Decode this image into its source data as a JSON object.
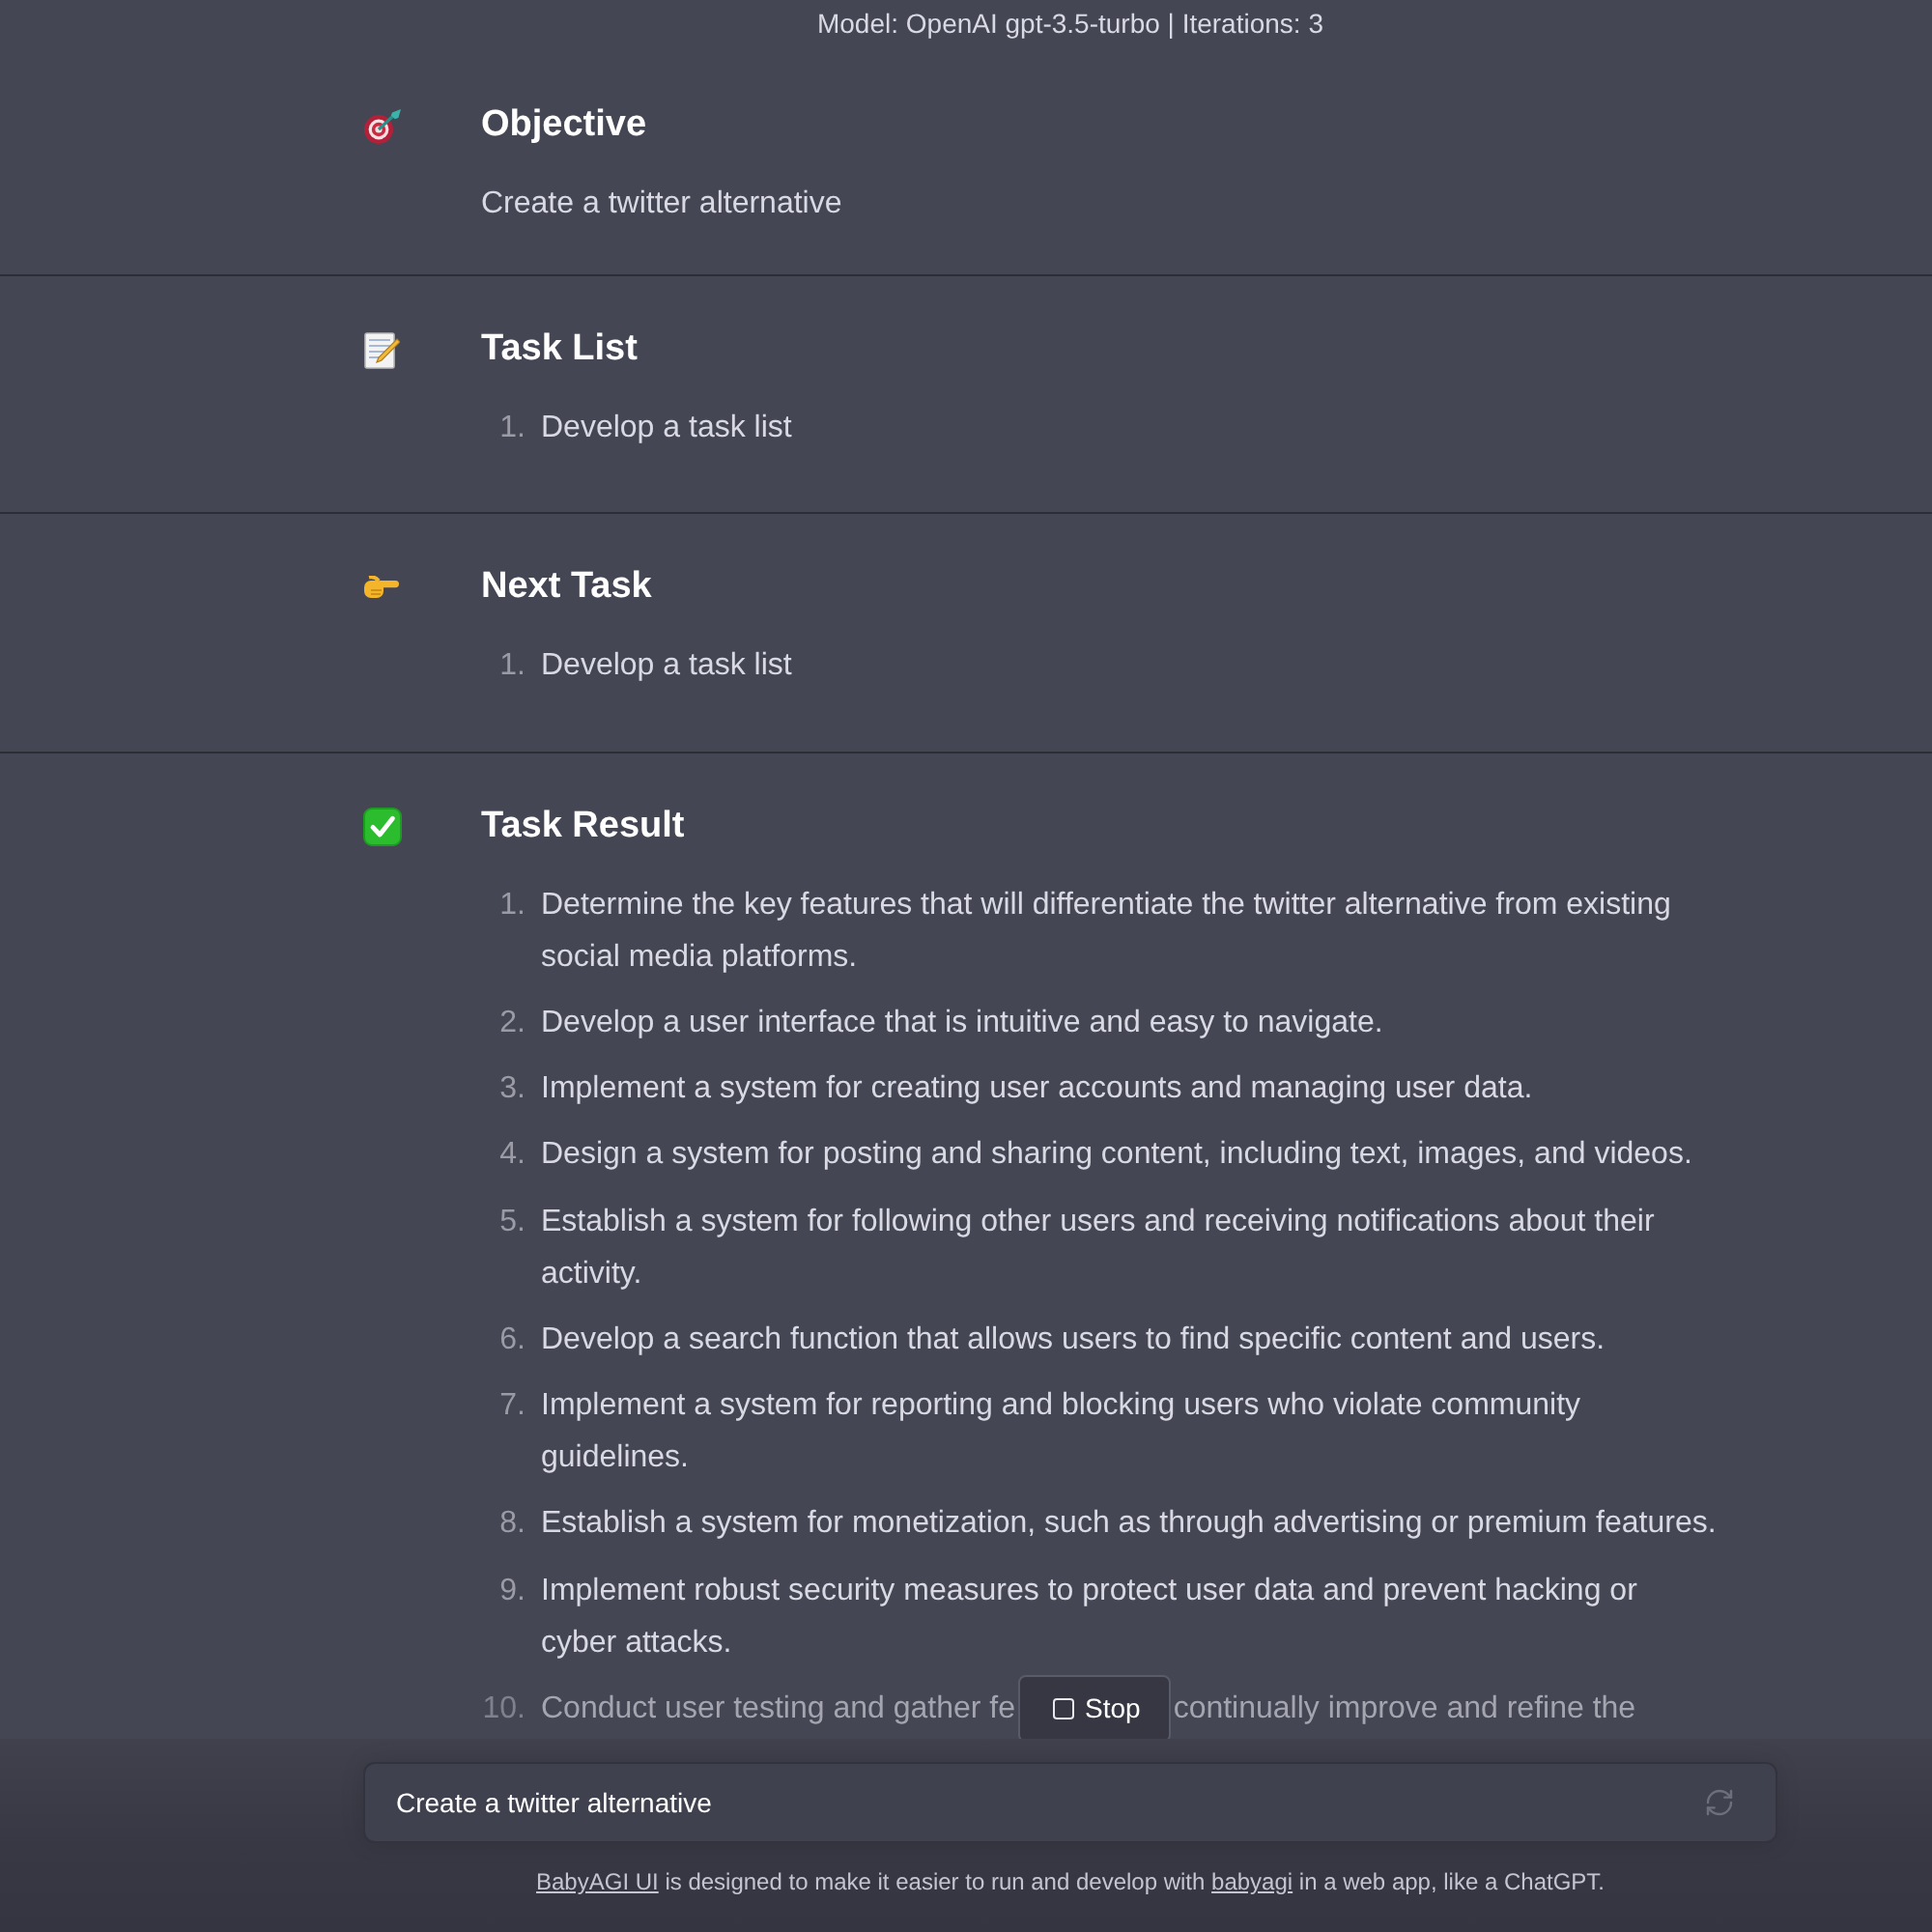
{
  "header": {
    "text": "Model: OpenAI gpt-3.5-turbo | Iterations: 3"
  },
  "sections": [
    {
      "kind": "objective",
      "title": "Objective",
      "text": "Create a twitter alternative"
    },
    {
      "kind": "tasks",
      "title": "Task List",
      "items": [
        {
          "number": "1.",
          "lines": [
            "Develop a task list"
          ],
          "faded": false
        }
      ]
    },
    {
      "kind": "next",
      "title": "Next Task",
      "items": [
        {
          "number": "1.",
          "lines": [
            "Develop a task list"
          ],
          "faded": false
        }
      ]
    },
    {
      "kind": "result",
      "title": "Task Result",
      "items": [
        {
          "number": "1.",
          "lines": [
            "Determine the key features that will differentiate the twitter alternative from existing",
            "social media platforms."
          ],
          "faded": false
        },
        {
          "number": "2.",
          "lines": [
            "Develop a user interface that is intuitive and easy to navigate."
          ],
          "faded": false
        },
        {
          "number": "3.",
          "lines": [
            "Implement a system for creating user accounts and managing user data."
          ],
          "faded": false
        },
        {
          "number": "4.",
          "lines": [
            "Design a system for posting and sharing content, including text, images, and videos."
          ],
          "faded": false
        },
        {
          "number": "5.",
          "lines": [
            "Establish a system for following other users and receiving notifications about their",
            "activity."
          ],
          "faded": false
        },
        {
          "number": "6.",
          "lines": [
            "Develop a search function that allows users to find specific content and users."
          ],
          "faded": false
        },
        {
          "number": "7.",
          "lines": [
            "Implement a system for reporting and blocking users who violate community",
            "guidelines."
          ],
          "faded": false
        },
        {
          "number": "8.",
          "lines": [
            "Establish a system for monetization, such as through advertising or premium features."
          ],
          "faded": false
        },
        {
          "number": "9.",
          "lines": [
            "Implement robust security measures to protect user data and prevent hacking or",
            "cyber attacks."
          ],
          "faded": false
        },
        {
          "number": "10.",
          "lines": [
            "Conduct user testing and gather fe"
          ],
          "text_after_button": "continually improve and refine the",
          "faded": true
        }
      ]
    }
  ],
  "stop_button": {
    "label": "Stop"
  },
  "prompt_field": {
    "value": "Create a twitter alternative"
  },
  "footer": {
    "parts": [
      {
        "kind": "link",
        "text": "BabyAGI UI"
      },
      {
        "kind": "text",
        "text": " is designed to make it easier to run and develop with "
      },
      {
        "kind": "link",
        "text": "babyagi"
      },
      {
        "kind": "text",
        "text": " in a web app, like a ChatGPT."
      }
    ]
  }
}
